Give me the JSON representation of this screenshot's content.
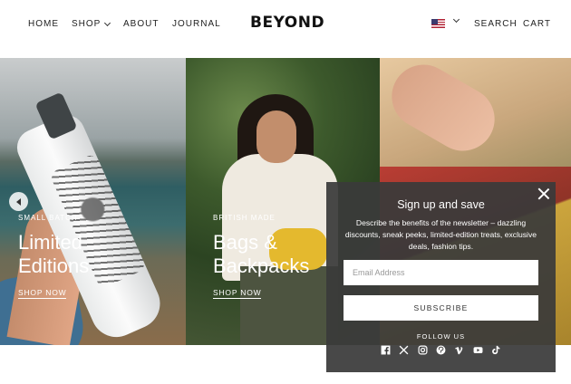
{
  "header": {
    "nav": {
      "home": "HOME",
      "shop": "SHOP",
      "about": "ABOUT",
      "journal": "JOURNAL"
    },
    "logo": "BEYOND",
    "search": "SEARCH",
    "cart": "CART",
    "currency_flag": "us-flag-icon"
  },
  "hero": {
    "panels": [
      {
        "tag": "SMALL BATCH",
        "title_line1": "Limited",
        "title_line2": "Editions",
        "link": "SHOP NOW"
      },
      {
        "tag": "BRITISH MADE",
        "title_line1": "Bags &",
        "title_line2": "Backpacks",
        "link": "SHOP NOW"
      }
    ]
  },
  "popup": {
    "title": "Sign up and save",
    "description": "Describe the benefits of the newsletter – dazzling discounts, sneak peeks, limited-edition treats, exclusive deals, fashion tips.",
    "email_placeholder": "Email Address",
    "subscribe": "SUBSCRIBE",
    "follow_us": "FOLLOW US",
    "socials": [
      "facebook-icon",
      "x-icon",
      "instagram-icon",
      "pinterest-icon",
      "vimeo-icon",
      "youtube-icon",
      "tiktok-icon"
    ]
  }
}
